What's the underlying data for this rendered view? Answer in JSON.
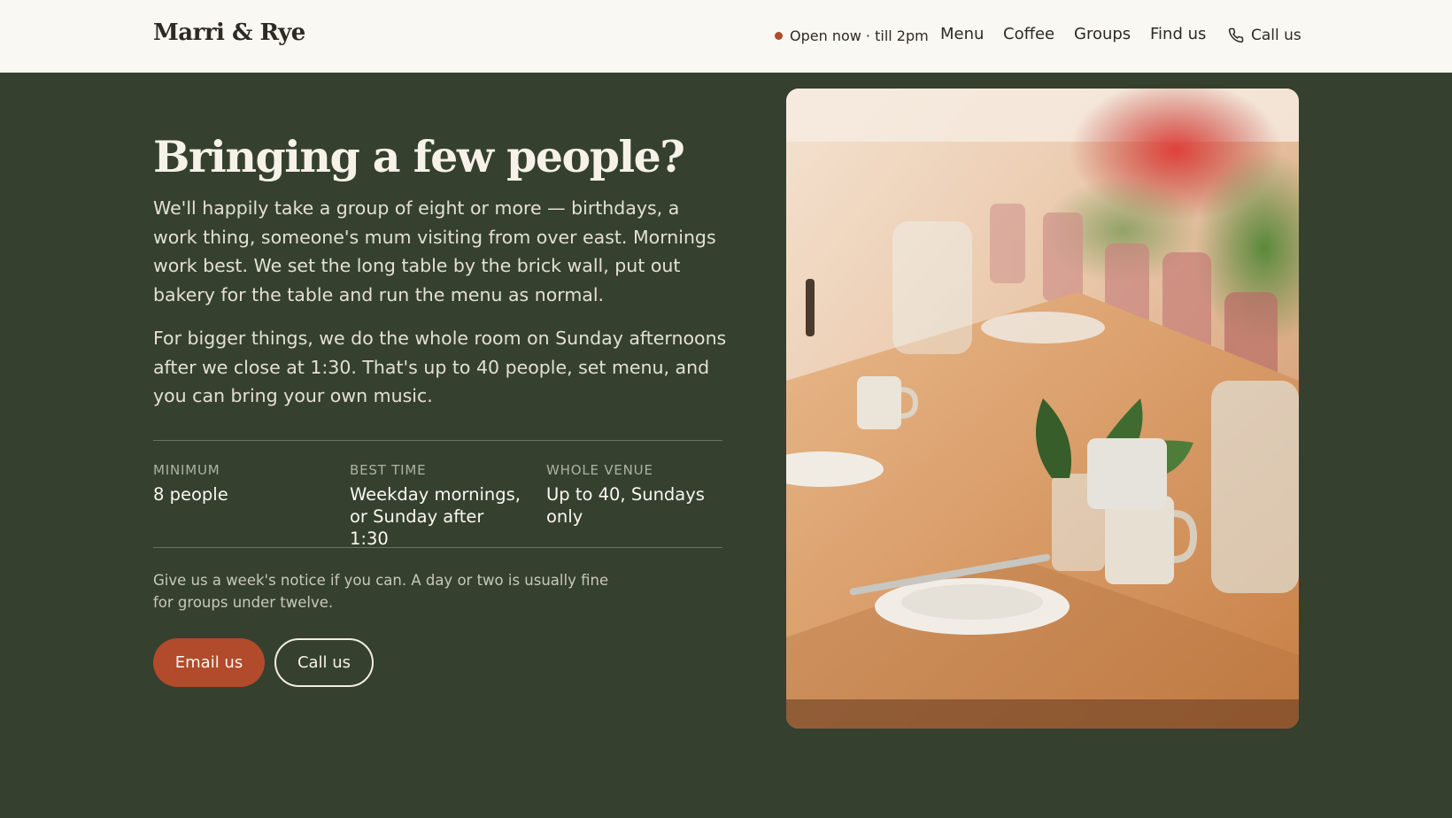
{
  "header": {
    "logo": "Marri & Rye",
    "status": "Open now · till 2pm",
    "nav": [
      "Menu",
      "Coffee",
      "Groups",
      "Find us"
    ],
    "call_label": "Call us"
  },
  "main": {
    "heading": "Bringing a few people?",
    "paragraph1": "We'll happily take a group of eight or more — birthdays, a work thing, someone's mum visiting from over east. Mornings work best. We set the long table by the brick wall, put out bakery for the table and run the menu as normal.",
    "paragraph2": "For bigger things, we do the whole room on Sunday afternoons after we close at 1:30. That's up to 40 people, set menu, and you can bring your own music.",
    "facts": [
      {
        "label": "MINIMUM",
        "value": "8 people"
      },
      {
        "label": "BEST TIME",
        "value": "Weekday mornings, or Sunday after 1:30"
      },
      {
        "label": "WHOLE VENUE",
        "value": "Up to 40, Sundays only"
      }
    ],
    "note": "Give us a week's notice if you can. A day or two is usually fine for groups under twelve.",
    "email_button": "Email us",
    "call_button": "Call us"
  },
  "colors": {
    "page_background": "#35402f",
    "header_background": "#faf8f3",
    "accent": "#b24a2c",
    "status_dot": "#b24a2c"
  }
}
